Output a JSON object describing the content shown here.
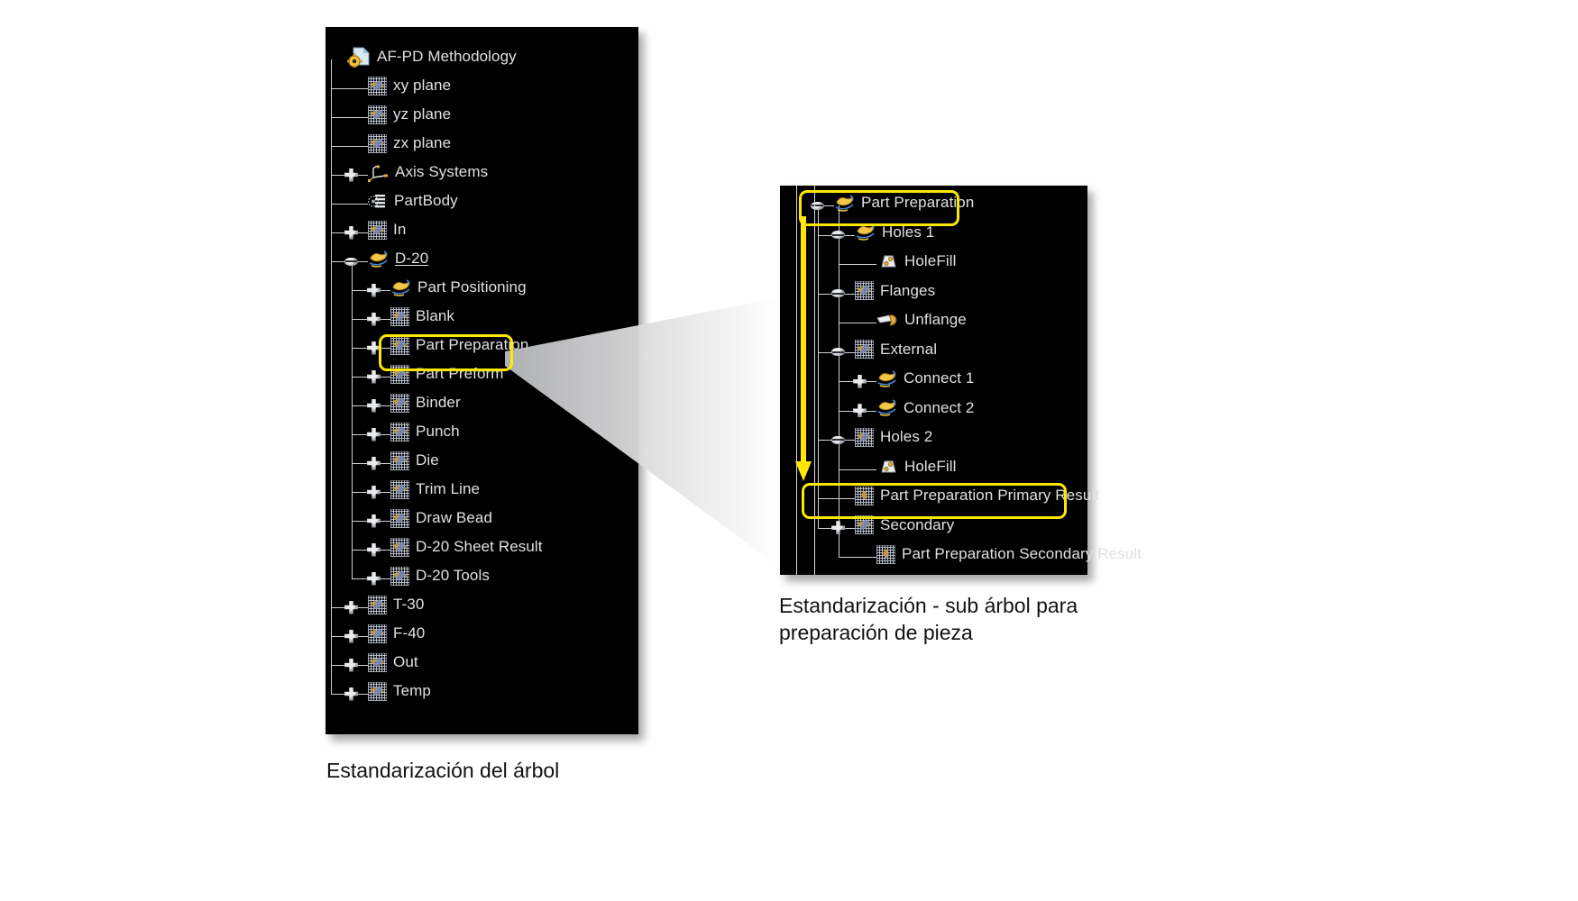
{
  "left_panel": {
    "title": "Estandarización del árbol",
    "root": {
      "label": "AF-PD Methodology",
      "icon": "document-gear-icon"
    },
    "nodes": [
      {
        "label": "AF-PD Methodology",
        "icon": "document-gear-icon",
        "depth": 0,
        "handle": "none",
        "underline": false
      },
      {
        "label": "xy plane",
        "icon": "plane-icon",
        "depth": 1,
        "handle": "none",
        "underline": false
      },
      {
        "label": "yz plane",
        "icon": "plane-icon",
        "depth": 1,
        "handle": "none",
        "underline": false
      },
      {
        "label": "zx plane",
        "icon": "plane-icon",
        "depth": 1,
        "handle": "none",
        "underline": false
      },
      {
        "label": "Axis Systems",
        "icon": "axis-system-icon",
        "depth": 1,
        "handle": "plus",
        "underline": false
      },
      {
        "label": "PartBody",
        "icon": "partbody-icon",
        "depth": 1,
        "handle": "none",
        "underline": false
      },
      {
        "label": "In",
        "icon": "feature-set-icon",
        "depth": 1,
        "handle": "plus",
        "underline": false
      },
      {
        "label": "D-20",
        "icon": "stamping-icon",
        "depth": 1,
        "handle": "minus",
        "underline": true
      },
      {
        "label": "Part Positioning",
        "icon": "stamping-icon",
        "depth": 2,
        "handle": "plus",
        "underline": false
      },
      {
        "label": "Blank",
        "icon": "feature-set-icon",
        "depth": 2,
        "handle": "plus",
        "underline": false
      },
      {
        "label": "Part Preparation",
        "icon": "feature-set-icon",
        "depth": 2,
        "handle": "plus",
        "underline": false,
        "highlighted": true
      },
      {
        "label": "Part Preform",
        "icon": "feature-set-icon",
        "depth": 2,
        "handle": "plus",
        "underline": false
      },
      {
        "label": "Binder",
        "icon": "feature-set-icon",
        "depth": 2,
        "handle": "plus",
        "underline": false
      },
      {
        "label": "Punch",
        "icon": "feature-set-icon",
        "depth": 2,
        "handle": "plus",
        "underline": false
      },
      {
        "label": "Die",
        "icon": "feature-set-icon",
        "depth": 2,
        "handle": "plus",
        "underline": false
      },
      {
        "label": "Trim Line",
        "icon": "feature-set-icon",
        "depth": 2,
        "handle": "plus",
        "underline": false
      },
      {
        "label": "Draw Bead",
        "icon": "feature-set-icon",
        "depth": 2,
        "handle": "plus",
        "underline": false
      },
      {
        "label": "D-20 Sheet Result",
        "icon": "feature-set-icon",
        "depth": 2,
        "handle": "plus",
        "underline": false
      },
      {
        "label": "D-20 Tools",
        "icon": "feature-set-icon",
        "depth": 2,
        "handle": "plus",
        "underline": false
      },
      {
        "label": "T-30",
        "icon": "feature-set-icon",
        "depth": 1,
        "handle": "plus",
        "underline": false
      },
      {
        "label": "F-40",
        "icon": "feature-set-icon",
        "depth": 1,
        "handle": "plus",
        "underline": false
      },
      {
        "label": "Out",
        "icon": "feature-set-icon",
        "depth": 1,
        "handle": "plus",
        "underline": false
      },
      {
        "label": "Temp",
        "icon": "feature-set-icon",
        "depth": 1,
        "handle": "plus",
        "underline": false
      }
    ]
  },
  "right_panel": {
    "title": "Estandarización - sub árbol para\npreparación de pieza",
    "nodes": [
      {
        "label": "Part Preparation",
        "icon": "stamping-icon",
        "depth": 0,
        "handle": "minus",
        "highlighted": true
      },
      {
        "label": "Holes 1",
        "icon": "stamping-icon",
        "depth": 1,
        "handle": "minus"
      },
      {
        "label": "HoleFill",
        "icon": "holefill-icon",
        "depth": 2,
        "handle": "none"
      },
      {
        "label": "Flanges",
        "icon": "feature-set-icon",
        "depth": 1,
        "handle": "minus"
      },
      {
        "label": "Unflange",
        "icon": "unflange-icon",
        "depth": 2,
        "handle": "none"
      },
      {
        "label": "External",
        "icon": "feature-set-icon",
        "depth": 1,
        "handle": "minus"
      },
      {
        "label": "Connect 1",
        "icon": "stamping-icon",
        "depth": 2,
        "handle": "plus"
      },
      {
        "label": "Connect 2",
        "icon": "stamping-icon",
        "depth": 2,
        "handle": "plus"
      },
      {
        "label": "Holes 2",
        "icon": "feature-set-icon",
        "depth": 1,
        "handle": "minus"
      },
      {
        "label": "HoleFill",
        "icon": "holefill-icon",
        "depth": 2,
        "handle": "none"
      },
      {
        "label": "Part Preparation Primary Result",
        "icon": "result-icon",
        "depth": 1,
        "handle": "none",
        "highlighted": true
      },
      {
        "label": "Secondary",
        "icon": "feature-set-icon",
        "depth": 1,
        "handle": "plus"
      },
      {
        "label": "Part Preparation Secondary Result",
        "icon": "result-icon",
        "depth": 2,
        "handle": "none"
      }
    ]
  },
  "colors": {
    "highlight": "#ffe800",
    "panel_background": "#000000",
    "tree_text": "#dfe0e2",
    "connector_line": "#cfd2d6",
    "page_background": "#ffffff",
    "caption_text": "#111214"
  }
}
